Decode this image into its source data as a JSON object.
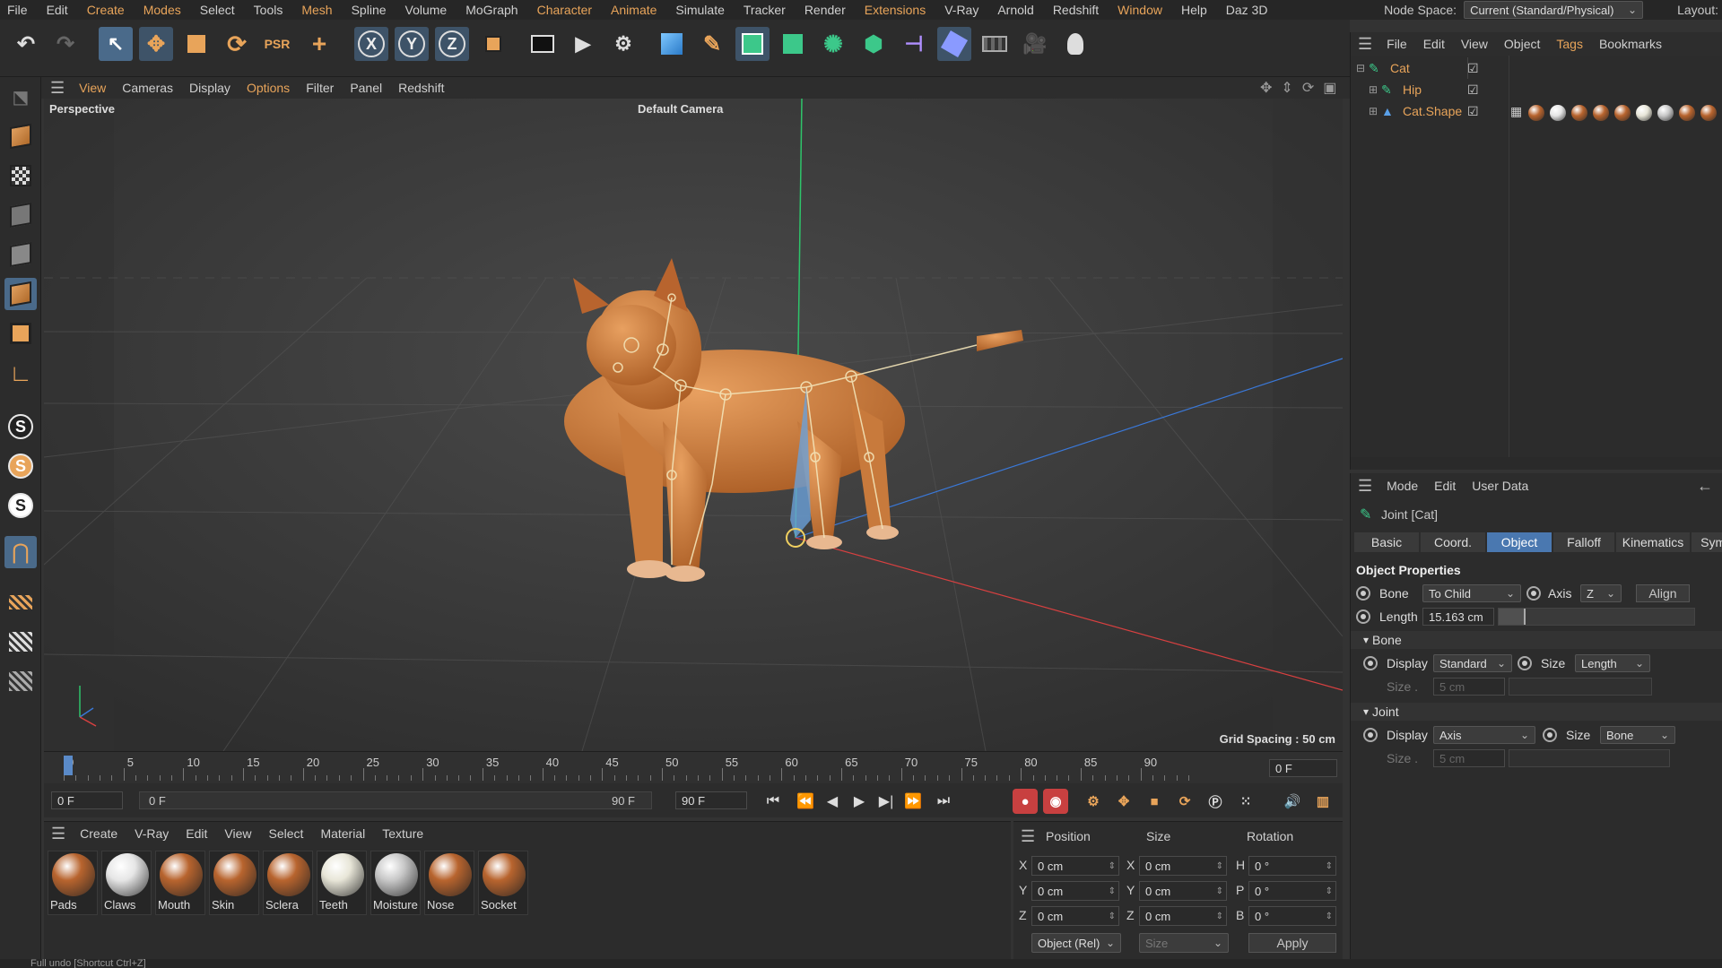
{
  "menubar": {
    "items": [
      "File",
      "Edit",
      "Create",
      "Modes",
      "Select",
      "Tools",
      "Mesh",
      "Spline",
      "Volume",
      "MoGraph",
      "Character",
      "Animate",
      "Simulate",
      "Tracker",
      "Render",
      "Extensions",
      "V-Ray",
      "Arnold",
      "Redshift",
      "Window",
      "Help",
      "Daz 3D"
    ],
    "highlighted": [
      "Create",
      "Modes",
      "Mesh",
      "Character",
      "Animate",
      "Extensions",
      "Window"
    ],
    "node_space_label": "Node Space:",
    "node_space_value": "Current (Standard/Physical)",
    "layout_label": "Layout:"
  },
  "viewport_menu": {
    "items": [
      "View",
      "Cameras",
      "Display",
      "Options",
      "Filter",
      "Panel",
      "Redshift"
    ],
    "highlighted": [
      "View",
      "Options"
    ]
  },
  "viewport": {
    "label": "Perspective",
    "camera": "Default Camera",
    "grid_spacing": "Grid Spacing : 50 cm"
  },
  "timeline": {
    "ticks": [
      "0",
      "5",
      "10",
      "15",
      "20",
      "25",
      "30",
      "35",
      "40",
      "45",
      "50",
      "55",
      "60",
      "65",
      "70",
      "75",
      "80",
      "85",
      "90"
    ],
    "current_frame_right": "0 F",
    "start_field": "0 F",
    "range_start": "0 F",
    "range_end": "90 F",
    "end_field": "90 F"
  },
  "material_manager": {
    "menu": [
      "Create",
      "V-Ray",
      "Edit",
      "View",
      "Select",
      "Material",
      "Texture"
    ],
    "materials": [
      {
        "name": "Pads",
        "color": "#b8642e"
      },
      {
        "name": "Claws",
        "color": "#e6e6e6"
      },
      {
        "name": "Mouth",
        "color": "#b8642e"
      },
      {
        "name": "Skin",
        "color": "#b8642e"
      },
      {
        "name": "Sclera",
        "color": "#b8642e"
      },
      {
        "name": "Teeth",
        "color": "#e8e6d8"
      },
      {
        "name": "Moisture",
        "color": "#c8c8c8"
      },
      {
        "name": "Nose",
        "color": "#b8642e"
      },
      {
        "name": "Socket",
        "color": "#b8642e"
      }
    ]
  },
  "coordinates": {
    "headers": {
      "position": "Position",
      "size": "Size",
      "rotation": "Rotation"
    },
    "rows": [
      {
        "axis": "X",
        "position": "0 cm",
        "size_axis": "X",
        "size": "0 cm",
        "rot_axis": "H",
        "rotation": "0 °"
      },
      {
        "axis": "Y",
        "position": "0 cm",
        "size_axis": "Y",
        "size": "0 cm",
        "rot_axis": "P",
        "rotation": "0 °"
      },
      {
        "axis": "Z",
        "position": "0 cm",
        "size_axis": "Z",
        "size": "0 cm",
        "rot_axis": "B",
        "rotation": "0 °"
      }
    ],
    "mode": "Object (Rel)",
    "size_mode": "Size",
    "apply_label": "Apply"
  },
  "object_manager": {
    "menu": [
      "File",
      "Edit",
      "View",
      "Object",
      "Tags",
      "Bookmarks"
    ],
    "highlighted": [
      "Tags"
    ],
    "objects": [
      "Cat",
      "Hip",
      "Cat.Shape"
    ]
  },
  "attribute_manager": {
    "menu": [
      "Mode",
      "Edit",
      "User Data"
    ],
    "title": "Joint [Cat]",
    "tabs": [
      "Basic",
      "Coord.",
      "Object",
      "Falloff",
      "Kinematics",
      "Symm"
    ],
    "active_tab": "Object",
    "section_title": "Object Properties",
    "bone_label": "Bone",
    "bone_value": "To Child",
    "axis_label": "Axis",
    "axis_value": "Z",
    "align_label": "Align",
    "length_label": "Length",
    "length_value": "15.163 cm",
    "bone_section": "Bone",
    "bone_display_label": "Display",
    "bone_display_value": "Standard",
    "bone_size_label": "Size",
    "bone_size_value": "Length",
    "bone_size2_label": "Size .",
    "bone_size2_value": "5 cm",
    "joint_section": "Joint",
    "joint_display_label": "Display",
    "joint_display_value": "Axis",
    "joint_size_label": "Size",
    "joint_size_value": "Bone",
    "joint_size2_label": "Size .",
    "joint_size2_value": "5 cm"
  },
  "status": "Full undo [Shortcut Ctrl+Z]",
  "colors": {
    "accent": "#e8a45a",
    "selection": "#4a78b0",
    "background": "#2c2c2c"
  }
}
